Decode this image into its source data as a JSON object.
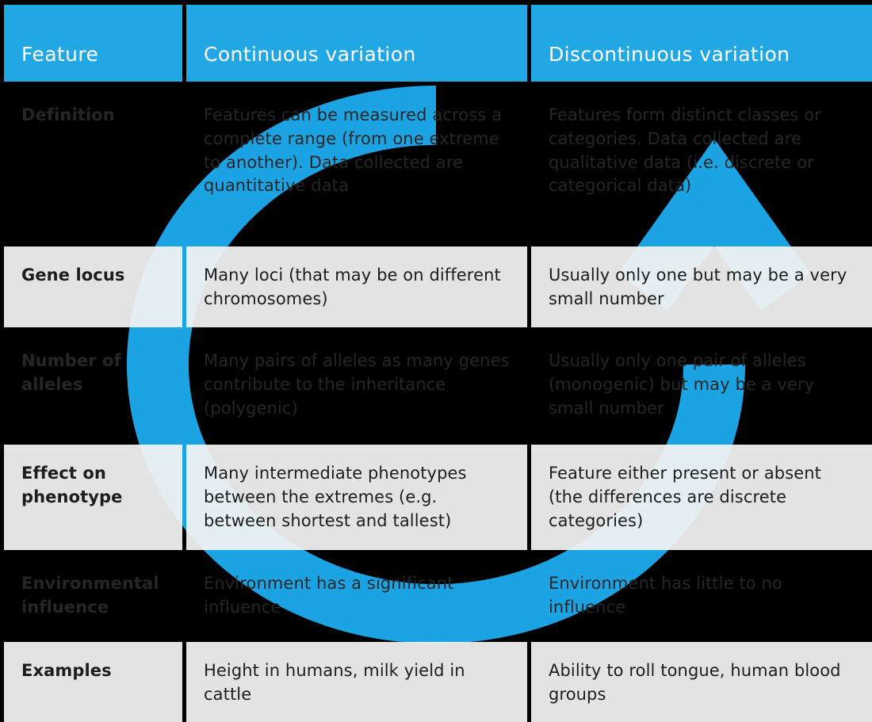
{
  "colors": {
    "header_blue": "#22a7e5",
    "watermark_blue": "#1ca3e3",
    "light_row_bg": "#f4f4f4",
    "dark_row_bg": "#000000",
    "dark_row_text": "#262626",
    "light_row_text": "#1d1d1d",
    "header_text": "#ffffff",
    "page_bg": "#000000"
  },
  "table": {
    "headers": [
      "Feature",
      "Continuous variation",
      "Discontinuous variation"
    ],
    "rows": [
      {
        "theme": "dark",
        "feature": "Definition",
        "continuous": "Features can be measured across a complete range (from one extreme to another).\nData collected are quantitative data",
        "discontinuous": "Features form distinct classes or categories. Data collected are qualitative data\n(i.e. discrete or categorical data)"
      },
      {
        "theme": "light",
        "feature": "Gene locus",
        "continuous": "Many loci (that may be on different chromosomes)",
        "discontinuous": "Usually only one but may be a very small number"
      },
      {
        "theme": "dark",
        "feature": "Number of alleles",
        "continuous": "Many pairs of alleles as many genes contribute to the inheritance (polygenic)",
        "discontinuous": "Usually only one pair of alleles (monogenic) but may be a very small number"
      },
      {
        "theme": "light",
        "feature": "Effect on phenotype",
        "continuous": "Many intermediate phenotypes between the extremes (e.g. between shortest and tallest)",
        "discontinuous": "Feature either present or absent (the differences are discrete categories)"
      },
      {
        "theme": "dark",
        "feature": "Environmental influence",
        "continuous": "Environment has a significant influence",
        "discontinuous": "Environment has little to no influence"
      },
      {
        "theme": "light",
        "feature": "Examples",
        "continuous": "Height in humans, milk yield in cattle",
        "discontinuous": "Ability to roll tongue, human blood groups"
      }
    ]
  },
  "watermark": {
    "icon": "circular-cycle-arrow-logo"
  }
}
